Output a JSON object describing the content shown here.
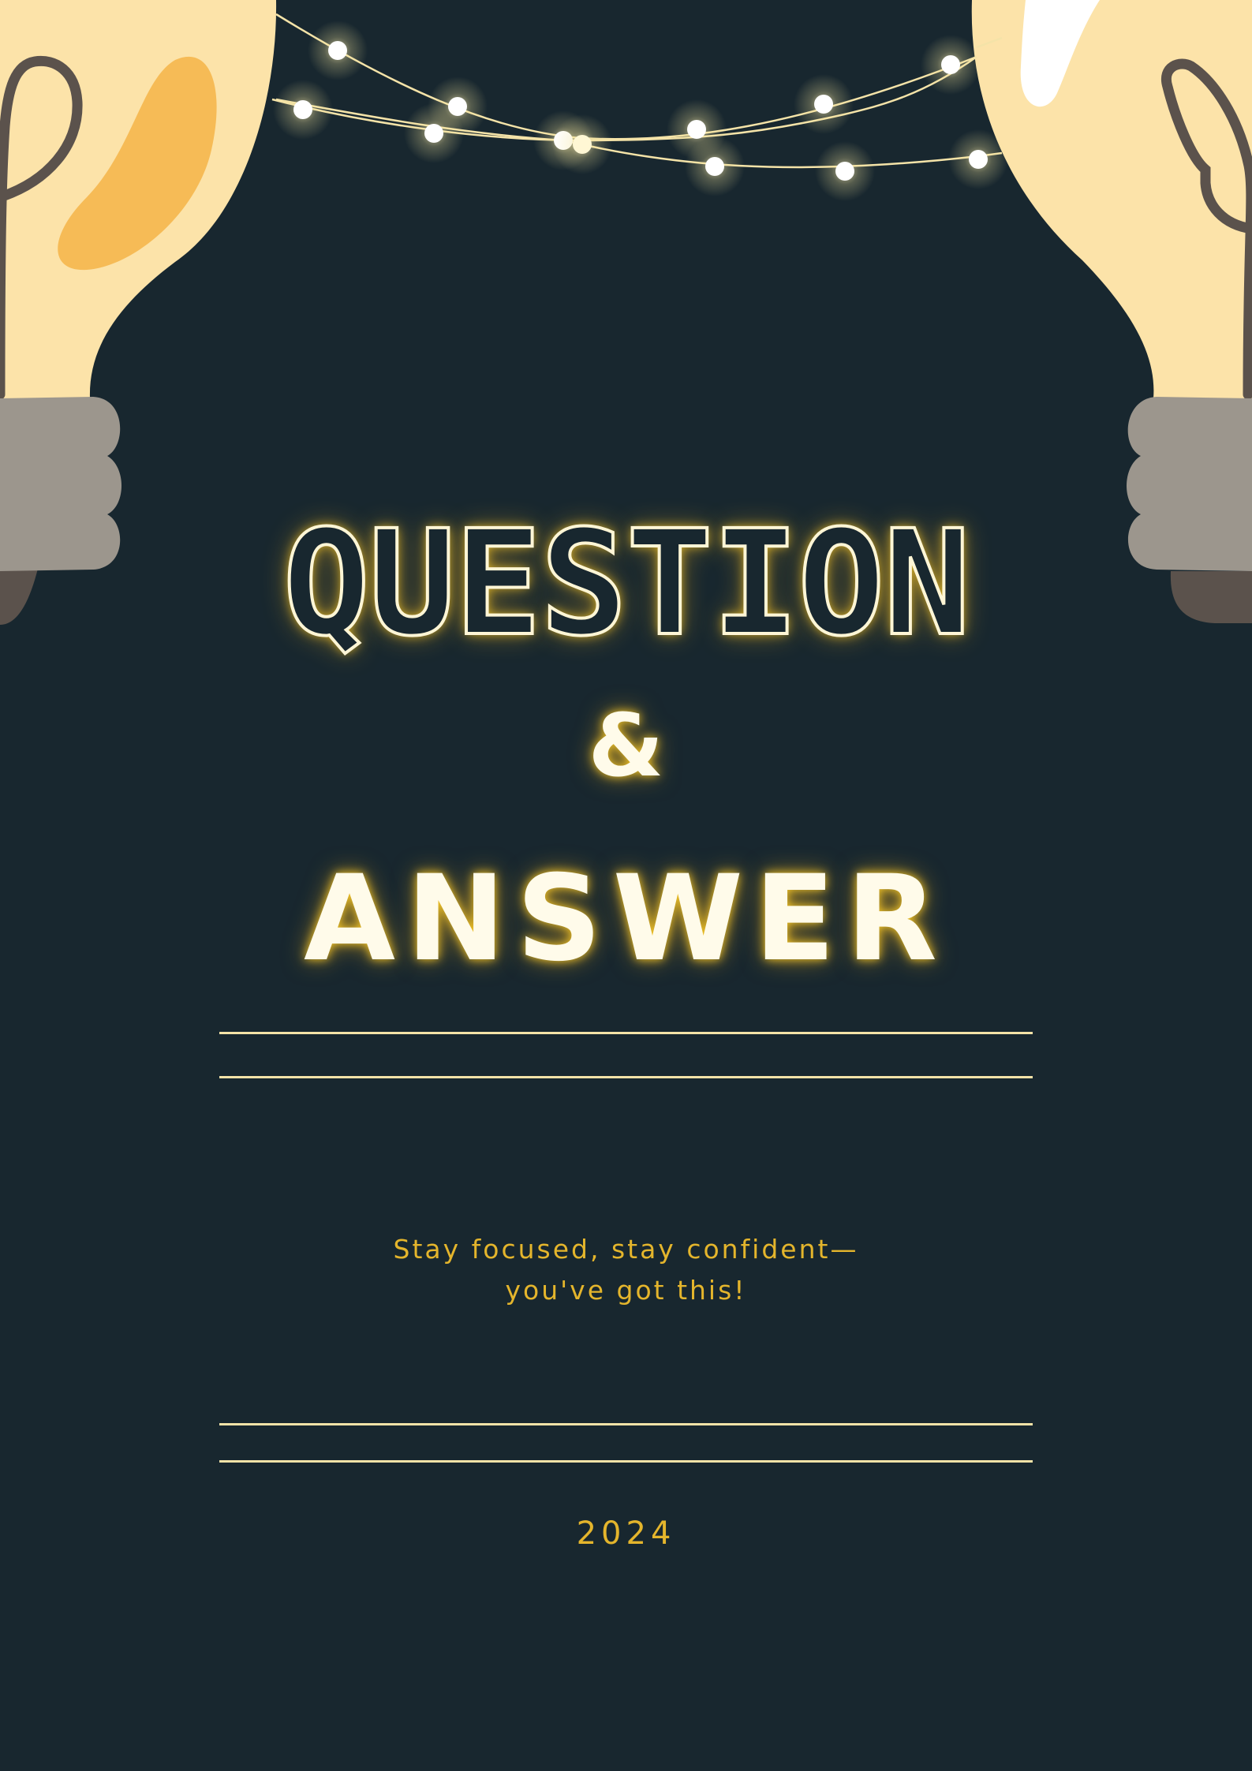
{
  "poster": {
    "title_line_1": "QUESTION",
    "title_line_2": "&",
    "title_line_3": "ANSWER",
    "tagline_line_1": "Stay focused, stay confident—",
    "tagline_line_2": "you've got this!",
    "year": "2024"
  },
  "colors": {
    "background": "#18272f",
    "bulb_glass": "#fce3a9",
    "bulb_highlight_left": "#f6bb56",
    "bulb_base": "#9c968d",
    "bulb_cap": "#5b524c",
    "filament": "#5b524c",
    "string_wire": "#f4e3a8",
    "glow_text": "#fffbea",
    "accent_text": "#e4b52c"
  },
  "icons": [
    "light-bulb-icon",
    "string-lights-icon"
  ]
}
